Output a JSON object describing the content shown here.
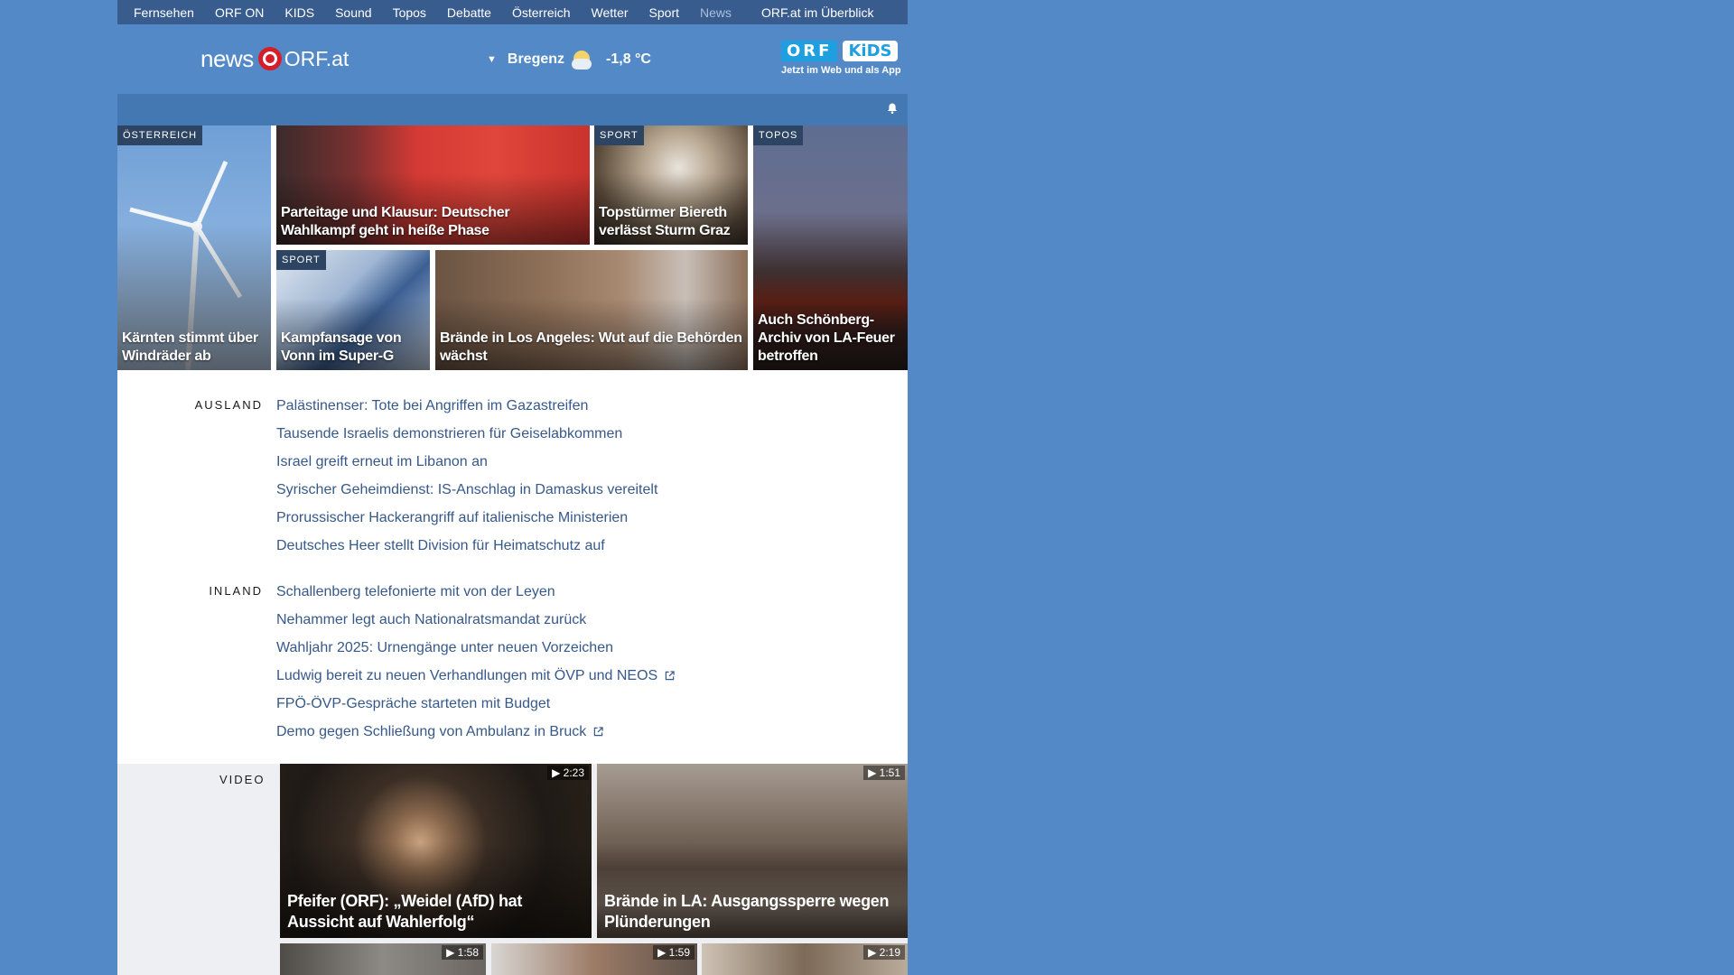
{
  "topnav": {
    "items": [
      "Fernsehen",
      "ORF ON",
      "KIDS",
      "Sound",
      "Topos",
      "Debatte",
      "Österreich",
      "Wetter",
      "Sport",
      "News"
    ],
    "overview": "ORF.at im Überblick"
  },
  "header": {
    "logo_news": "news",
    "logo_orf": "ORF.at",
    "weather": {
      "city": "Bregenz",
      "temp": "-1,8 °C",
      "icon": "partly-cloudy-icon"
    },
    "kids": {
      "badge_orf": "ORF",
      "badge_kids": "KiDS",
      "tagline": "Jetzt im Web und als App"
    }
  },
  "tiles": [
    {
      "category": "ÖSTERREICH",
      "title": "Kärnten stimmt über Windräder ab"
    },
    {
      "category": "",
      "title": "Parteitage und Klausur: Deutscher Wahlkampf geht in heiße Phase"
    },
    {
      "category": "SPORT",
      "title": "Topstürmer Biereth verlässt Sturm Graz"
    },
    {
      "category": "TOPOS",
      "title": "Auch Schönberg-Archiv von LA-Feuer betroffen"
    },
    {
      "category": "SPORT",
      "title": "Kampfansage von Vonn im Super-G"
    },
    {
      "category": "",
      "title": "Brände in Los Angeles: Wut auf die Behörden wächst"
    }
  ],
  "sections": [
    {
      "label": "AUSLAND",
      "stories": [
        "Palästinenser: Tote bei Angriffen im Gazastreifen",
        "Tausende Israelis demonstrieren für Geiselabkommen",
        "Israel greift erneut im Libanon an",
        "Syrischer Geheimdienst: IS-Anschlag in Damaskus vereitelt",
        "Prorussischer Hackerangriff auf italienische Ministerien",
        "Deutsches Heer stellt Division für Heimatschutz auf"
      ]
    },
    {
      "label": "INLAND",
      "stories": [
        "Schallenberg telefonierte mit von der Leyen",
        "Nehammer legt auch Nationalratsmandat zurück",
        "Wahljahr 2025: Urnengänge unter neuen Vorzeichen",
        "Ludwig bereit zu neuen Verhandlungen mit ÖVP und NEOS",
        "FPÖ-ÖVP-Gespräche starteten mit Budget",
        "Demo gegen Schließung von Ambulanz in Bruck"
      ]
    }
  ],
  "video": {
    "label": "VIDEO",
    "items": [
      {
        "duration": "2:23",
        "title": "Pfeifer (ORF): „Weidel (AfD) hat Aussicht auf Wahlerfolg“"
      },
      {
        "duration": "1:51",
        "title": "Brände in LA: Ausgangssperre wegen Plünderungen"
      },
      {
        "duration": "1:58",
        "title": ""
      },
      {
        "duration": "1:59",
        "title": ""
      },
      {
        "duration": "2:19",
        "title": ""
      }
    ]
  }
}
